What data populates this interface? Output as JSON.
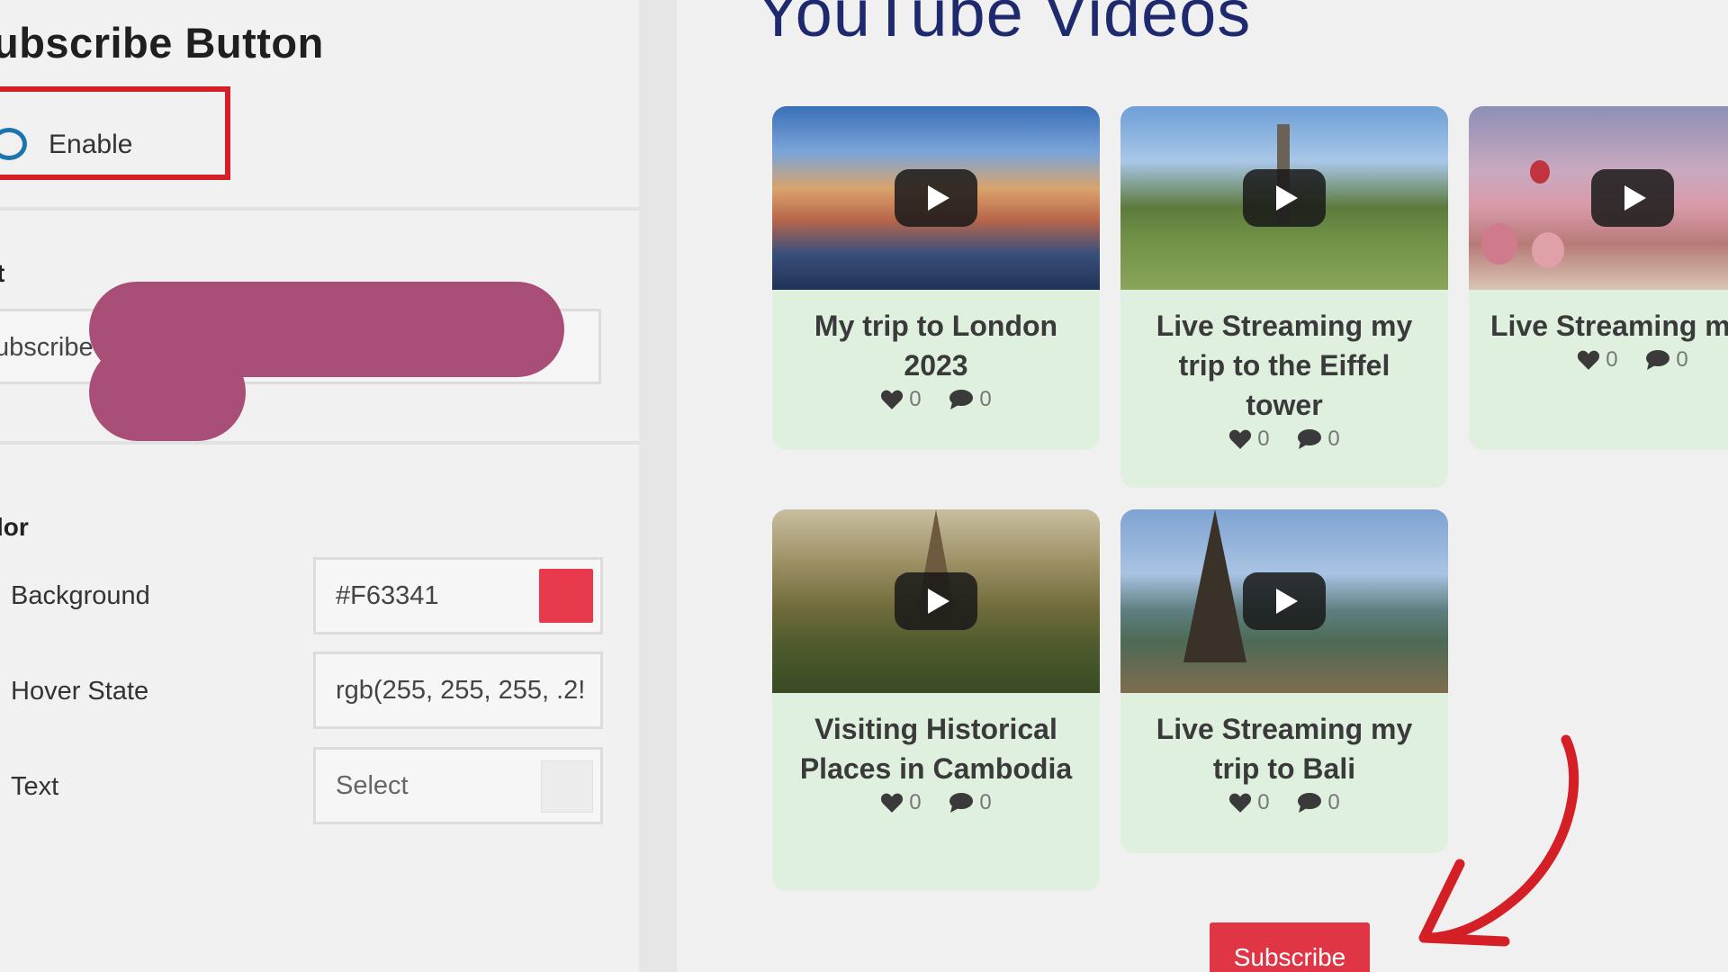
{
  "settings": {
    "section_title": "ubscribe Button",
    "enable_label": "Enable",
    "text_section_label": "t",
    "text_value": "ubscribe",
    "color_section_label": "lor",
    "rows": [
      {
        "label": "Background",
        "value": "#F63341",
        "swatch": "#e83a4c"
      },
      {
        "label": "Hover State",
        "value": "rgb(255, 255, 255, .2!"
      },
      {
        "label": "Text",
        "value": "Select"
      }
    ]
  },
  "preview": {
    "title": "YouTube Videos",
    "videos": [
      {
        "title": "My trip to London 2023",
        "likes": "0",
        "comments": "0"
      },
      {
        "title": "Live Streaming my trip to the Eiffel tower",
        "likes": "0",
        "comments": "0"
      },
      {
        "title": "Live Streaming my visit to Turke",
        "likes": "0",
        "comments": "0"
      },
      {
        "title": "Visiting Historical Places in Cambodia",
        "likes": "0",
        "comments": "0"
      },
      {
        "title": "Live Streaming my trip to Bali",
        "likes": "0",
        "comments": "0"
      }
    ],
    "subscribe_label": "Subscribe"
  },
  "colors": {
    "accent_red": "#d51f26",
    "redaction": "#a84e77",
    "card_bg": "#dff0df",
    "title_navy": "#1f2a6e",
    "toggle_blue": "#1d73ad"
  }
}
